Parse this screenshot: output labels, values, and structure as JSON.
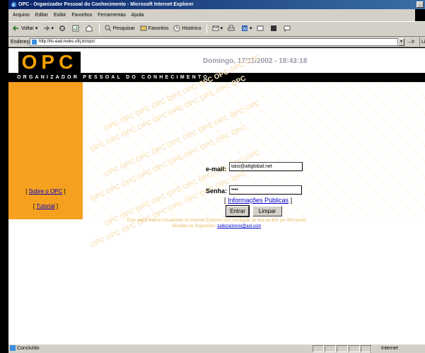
{
  "window": {
    "title": "OPC - Organizador Pessoal do Conhecimento - Microsoft Internet Explorer",
    "menu": [
      "Arquivo",
      "Editar",
      "Exibir",
      "Favoritos",
      "Ferramentas",
      "Ajuda"
    ],
    "toolbar": {
      "back": "Voltar",
      "search": "Pesquisar",
      "favorites": "Favoritos",
      "history": "Histórico"
    },
    "address": {
      "label": "Endereço",
      "url": "http://ltc-ead.nutes.ufrj.br/opc/",
      "go": "Ir",
      "links": "Lin"
    },
    "status": {
      "text": "Concluído",
      "zone": "Internet"
    }
  },
  "page": {
    "logo": "OPC",
    "datetime": "Domingo, 17/11/2002 - 18:43:18",
    "tagline": "ORGANIZADOR PESSOAL DO CONHECIMENTO",
    "sidebar": {
      "about": "Sobre o OPC",
      "tutorial": "Tutorial"
    },
    "login": {
      "email_label": "e-mail:",
      "email_value": "taisi@attglobal.net",
      "password_label": "Senha:",
      "password_value": "••••",
      "submit": "Entrar",
      "clear": "Limpar"
    },
    "public_info": "Informações Públicas",
    "footer": {
      "line1": "Este site é melhor visualizado no Internet Explorer com resolução de tela de 800 por 600 pixels",
      "line2_prefix": "Dúvidas ou Sugestões:",
      "email": "zallezantonio@aol.com"
    },
    "colors": {
      "accent": "#f5a01e",
      "link": "#0000cc",
      "datetime": "#9a9aaa"
    }
  }
}
